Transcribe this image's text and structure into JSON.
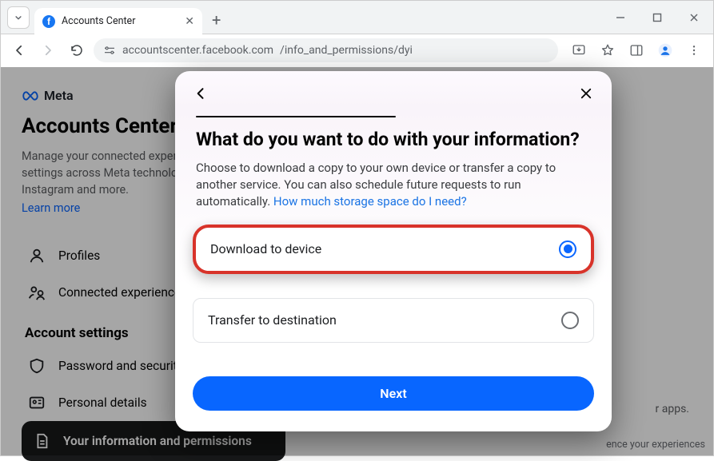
{
  "browser": {
    "tab_title": "Accounts Center",
    "url_host": "accountscenter.facebook.com",
    "url_path": "/info_and_permissions/dyi"
  },
  "page": {
    "brand": "Meta",
    "title": "Accounts Center",
    "description": "Manage your connected experiences and account settings across Meta technologies like Facebook, Instagram and more.",
    "learn_more": "Learn more"
  },
  "sidebar": {
    "section1": [
      {
        "label": "Profiles"
      },
      {
        "label": "Connected experiences"
      }
    ],
    "section2_head": "Account settings",
    "section2": [
      {
        "label": "Password and security"
      },
      {
        "label": "Personal details"
      },
      {
        "label": "Your information and permissions"
      }
    ]
  },
  "right_text_apps": "r apps.",
  "right_text_exp": "ence your experiences",
  "modal": {
    "title": "What do you want to do with your information?",
    "description_pre": "Choose to download a copy to your own device or transfer a copy to another service. You can also schedule future requests to run automatically. ",
    "storage_link": "How much storage space do I need?",
    "options": [
      {
        "label": "Download to device",
        "selected": true
      },
      {
        "label": "Transfer to destination",
        "selected": false
      }
    ],
    "next": "Next"
  }
}
